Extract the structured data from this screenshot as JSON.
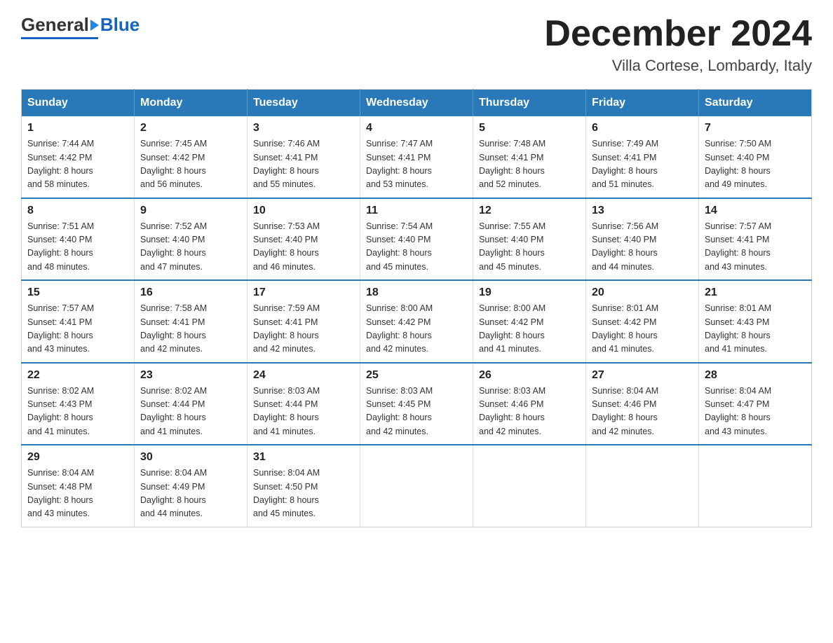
{
  "logo": {
    "general": "General",
    "blue": "Blue"
  },
  "title": {
    "month": "December 2024",
    "location": "Villa Cortese, Lombardy, Italy"
  },
  "weekdays": [
    "Sunday",
    "Monday",
    "Tuesday",
    "Wednesday",
    "Thursday",
    "Friday",
    "Saturday"
  ],
  "weeks": [
    [
      {
        "day": "1",
        "info": "Sunrise: 7:44 AM\nSunset: 4:42 PM\nDaylight: 8 hours\nand 58 minutes."
      },
      {
        "day": "2",
        "info": "Sunrise: 7:45 AM\nSunset: 4:42 PM\nDaylight: 8 hours\nand 56 minutes."
      },
      {
        "day": "3",
        "info": "Sunrise: 7:46 AM\nSunset: 4:41 PM\nDaylight: 8 hours\nand 55 minutes."
      },
      {
        "day": "4",
        "info": "Sunrise: 7:47 AM\nSunset: 4:41 PM\nDaylight: 8 hours\nand 53 minutes."
      },
      {
        "day": "5",
        "info": "Sunrise: 7:48 AM\nSunset: 4:41 PM\nDaylight: 8 hours\nand 52 minutes."
      },
      {
        "day": "6",
        "info": "Sunrise: 7:49 AM\nSunset: 4:41 PM\nDaylight: 8 hours\nand 51 minutes."
      },
      {
        "day": "7",
        "info": "Sunrise: 7:50 AM\nSunset: 4:40 PM\nDaylight: 8 hours\nand 49 minutes."
      }
    ],
    [
      {
        "day": "8",
        "info": "Sunrise: 7:51 AM\nSunset: 4:40 PM\nDaylight: 8 hours\nand 48 minutes."
      },
      {
        "day": "9",
        "info": "Sunrise: 7:52 AM\nSunset: 4:40 PM\nDaylight: 8 hours\nand 47 minutes."
      },
      {
        "day": "10",
        "info": "Sunrise: 7:53 AM\nSunset: 4:40 PM\nDaylight: 8 hours\nand 46 minutes."
      },
      {
        "day": "11",
        "info": "Sunrise: 7:54 AM\nSunset: 4:40 PM\nDaylight: 8 hours\nand 45 minutes."
      },
      {
        "day": "12",
        "info": "Sunrise: 7:55 AM\nSunset: 4:40 PM\nDaylight: 8 hours\nand 45 minutes."
      },
      {
        "day": "13",
        "info": "Sunrise: 7:56 AM\nSunset: 4:40 PM\nDaylight: 8 hours\nand 44 minutes."
      },
      {
        "day": "14",
        "info": "Sunrise: 7:57 AM\nSunset: 4:41 PM\nDaylight: 8 hours\nand 43 minutes."
      }
    ],
    [
      {
        "day": "15",
        "info": "Sunrise: 7:57 AM\nSunset: 4:41 PM\nDaylight: 8 hours\nand 43 minutes."
      },
      {
        "day": "16",
        "info": "Sunrise: 7:58 AM\nSunset: 4:41 PM\nDaylight: 8 hours\nand 42 minutes."
      },
      {
        "day": "17",
        "info": "Sunrise: 7:59 AM\nSunset: 4:41 PM\nDaylight: 8 hours\nand 42 minutes."
      },
      {
        "day": "18",
        "info": "Sunrise: 8:00 AM\nSunset: 4:42 PM\nDaylight: 8 hours\nand 42 minutes."
      },
      {
        "day": "19",
        "info": "Sunrise: 8:00 AM\nSunset: 4:42 PM\nDaylight: 8 hours\nand 41 minutes."
      },
      {
        "day": "20",
        "info": "Sunrise: 8:01 AM\nSunset: 4:42 PM\nDaylight: 8 hours\nand 41 minutes."
      },
      {
        "day": "21",
        "info": "Sunrise: 8:01 AM\nSunset: 4:43 PM\nDaylight: 8 hours\nand 41 minutes."
      }
    ],
    [
      {
        "day": "22",
        "info": "Sunrise: 8:02 AM\nSunset: 4:43 PM\nDaylight: 8 hours\nand 41 minutes."
      },
      {
        "day": "23",
        "info": "Sunrise: 8:02 AM\nSunset: 4:44 PM\nDaylight: 8 hours\nand 41 minutes."
      },
      {
        "day": "24",
        "info": "Sunrise: 8:03 AM\nSunset: 4:44 PM\nDaylight: 8 hours\nand 41 minutes."
      },
      {
        "day": "25",
        "info": "Sunrise: 8:03 AM\nSunset: 4:45 PM\nDaylight: 8 hours\nand 42 minutes."
      },
      {
        "day": "26",
        "info": "Sunrise: 8:03 AM\nSunset: 4:46 PM\nDaylight: 8 hours\nand 42 minutes."
      },
      {
        "day": "27",
        "info": "Sunrise: 8:04 AM\nSunset: 4:46 PM\nDaylight: 8 hours\nand 42 minutes."
      },
      {
        "day": "28",
        "info": "Sunrise: 8:04 AM\nSunset: 4:47 PM\nDaylight: 8 hours\nand 43 minutes."
      }
    ],
    [
      {
        "day": "29",
        "info": "Sunrise: 8:04 AM\nSunset: 4:48 PM\nDaylight: 8 hours\nand 43 minutes."
      },
      {
        "day": "30",
        "info": "Sunrise: 8:04 AM\nSunset: 4:49 PM\nDaylight: 8 hours\nand 44 minutes."
      },
      {
        "day": "31",
        "info": "Sunrise: 8:04 AM\nSunset: 4:50 PM\nDaylight: 8 hours\nand 45 minutes."
      },
      null,
      null,
      null,
      null
    ]
  ]
}
